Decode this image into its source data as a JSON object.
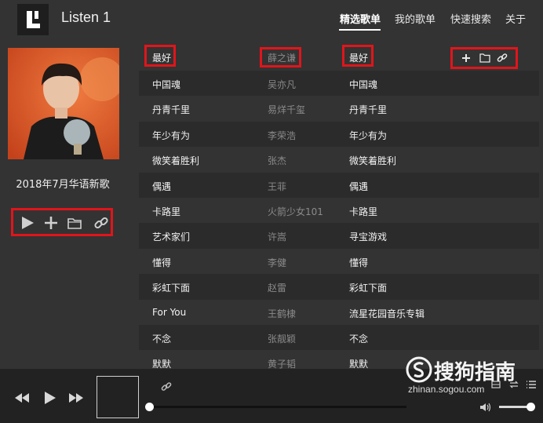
{
  "app": {
    "title": "Listen 1"
  },
  "nav": [
    {
      "label": "精选歌单",
      "active": true
    },
    {
      "label": "我的歌单",
      "active": false
    },
    {
      "label": "快速搜索",
      "active": false
    },
    {
      "label": "关于",
      "active": false
    }
  ],
  "sidebar": {
    "playlist_title": "2018年7月华语新歌",
    "controls": [
      "play-icon",
      "add-icon",
      "folder-icon",
      "link-icon"
    ]
  },
  "song_list": {
    "header": {
      "title": "最好",
      "artist": "薛之谦",
      "album": "最好",
      "actions": [
        "add-icon",
        "folder-icon",
        "link-icon"
      ]
    },
    "rows": [
      {
        "title": "中国魂",
        "artist": "吴亦凡",
        "album": "中国魂"
      },
      {
        "title": "丹青千里",
        "artist": "易烊千玺",
        "album": "丹青千里"
      },
      {
        "title": "年少有为",
        "artist": "李荣浩",
        "album": "年少有为"
      },
      {
        "title": "微笑着胜利",
        "artist": "张杰",
        "album": "微笑着胜利"
      },
      {
        "title": "偶遇",
        "artist": "王菲",
        "album": "偶遇"
      },
      {
        "title": "卡路里",
        "artist": "火箭少女101",
        "album": "卡路里"
      },
      {
        "title": "艺术家们",
        "artist": "许嵩",
        "album": "寻宝游戏"
      },
      {
        "title": "懂得",
        "artist": "李健",
        "album": "懂得"
      },
      {
        "title": "彩虹下面",
        "artist": "赵雷",
        "album": "彩虹下面"
      },
      {
        "title": "For You",
        "artist": "王鹤棣",
        "album": "流星花园音乐专辑"
      },
      {
        "title": "不念",
        "artist": "张靓颖",
        "album": "不念"
      },
      {
        "title": "默默",
        "artist": "黄子韬",
        "album": "默默"
      }
    ]
  },
  "player": {
    "controls": [
      "previous-icon",
      "play-icon",
      "next-icon"
    ],
    "progress": 0,
    "volume": 0.9
  },
  "watermark": {
    "text": "搜狗指南",
    "url": "zhinan.sogou.com"
  },
  "colors": {
    "background": "#333333",
    "highlight": "#e0151b",
    "player_bar": "#222222"
  }
}
